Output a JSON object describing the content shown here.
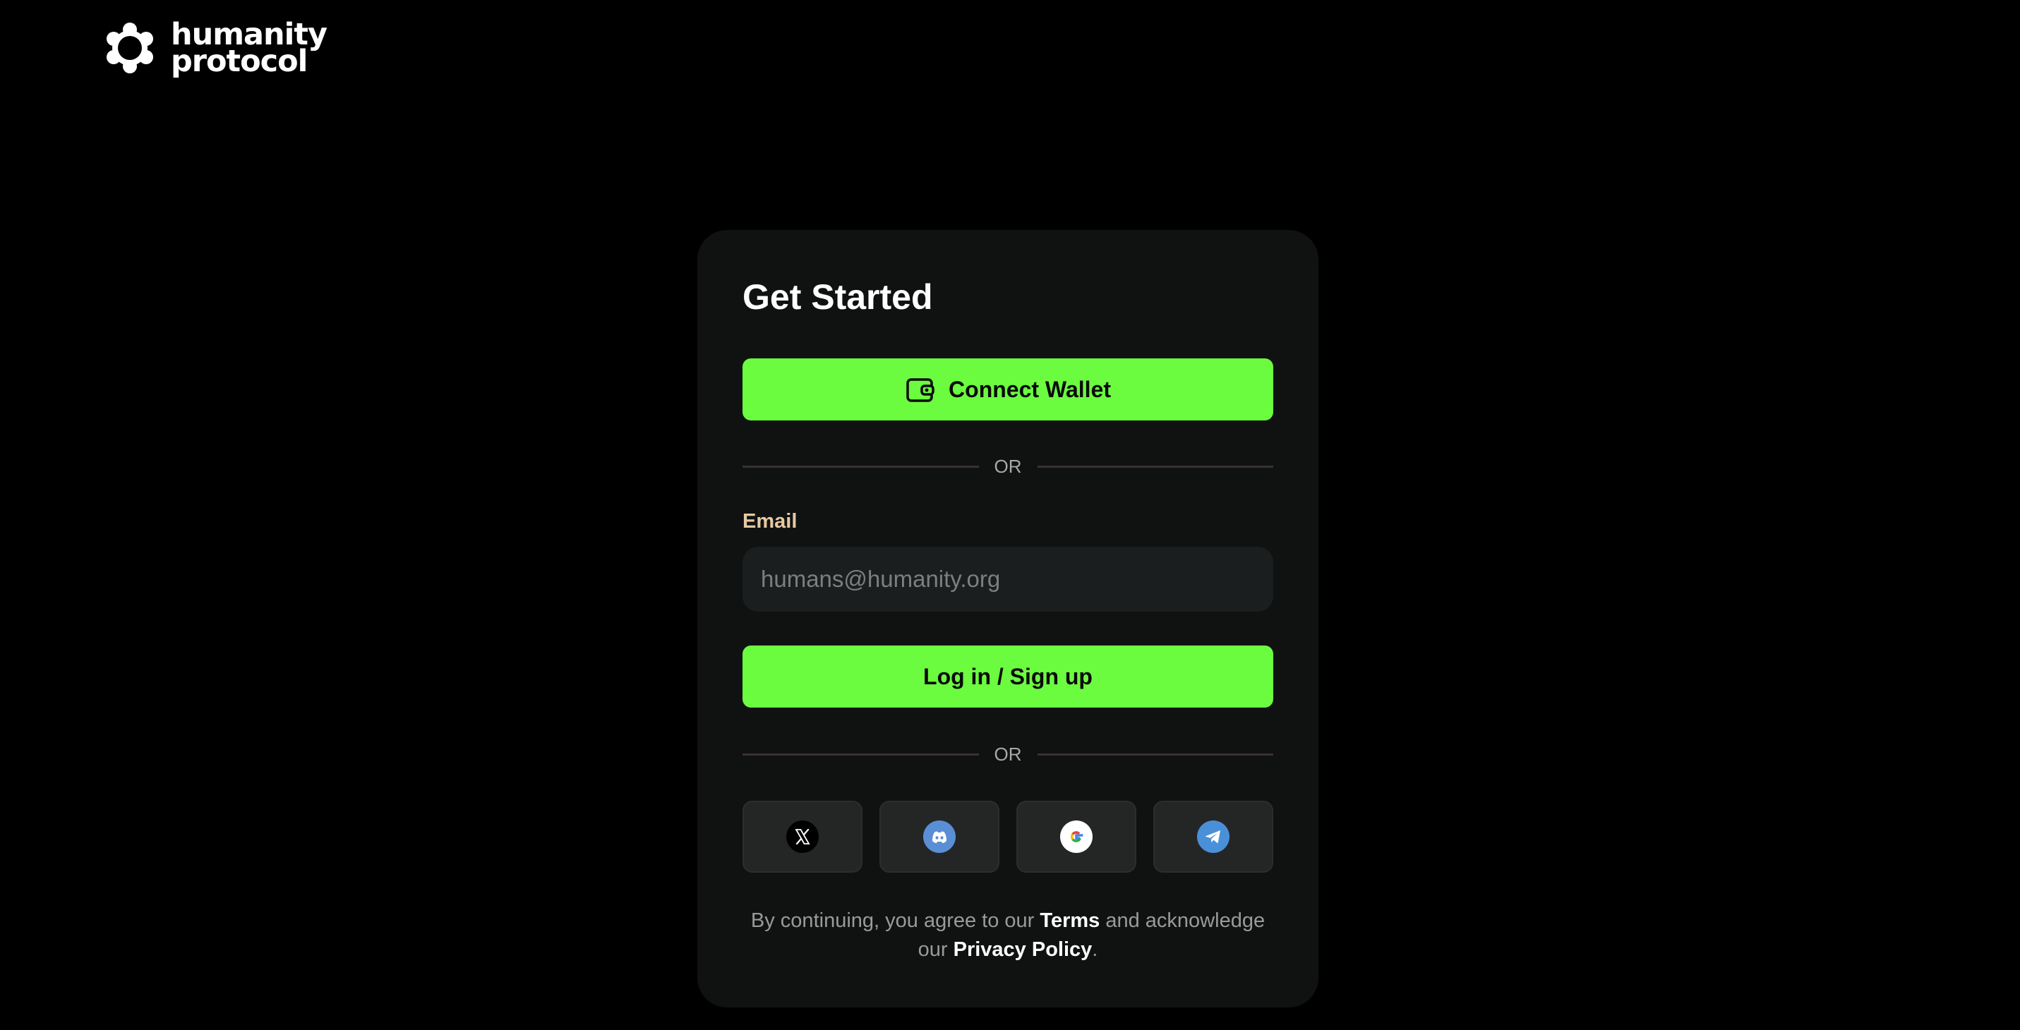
{
  "brand": {
    "name_line1": "humanity",
    "name_line2": "protocol",
    "logo_icon": "humanity-logo-icon"
  },
  "card": {
    "title": "Get Started",
    "connect_wallet": {
      "label": "Connect Wallet",
      "icon": "wallet-icon"
    },
    "divider_text": "OR",
    "email": {
      "label": "Email",
      "placeholder": "humans@humanity.org",
      "value": ""
    },
    "login_button": "Log in / Sign up",
    "social": [
      {
        "name": "X",
        "icon": "x-icon"
      },
      {
        "name": "Discord",
        "icon": "discord-icon"
      },
      {
        "name": "Google",
        "icon": "google-icon"
      },
      {
        "name": "Telegram",
        "icon": "telegram-icon"
      }
    ],
    "legal": {
      "prefix": "By continuing, you agree to our",
      "terms": "Terms",
      "middle": "and acknowledge our",
      "privacy": "Privacy Policy",
      "suffix": "."
    }
  },
  "colors": {
    "background": "#000000",
    "card": "#101212",
    "accent": "#6bfb3f",
    "label": "#e7c9a2",
    "discord": "#5a8fd6",
    "telegram": "#4a90d9"
  }
}
